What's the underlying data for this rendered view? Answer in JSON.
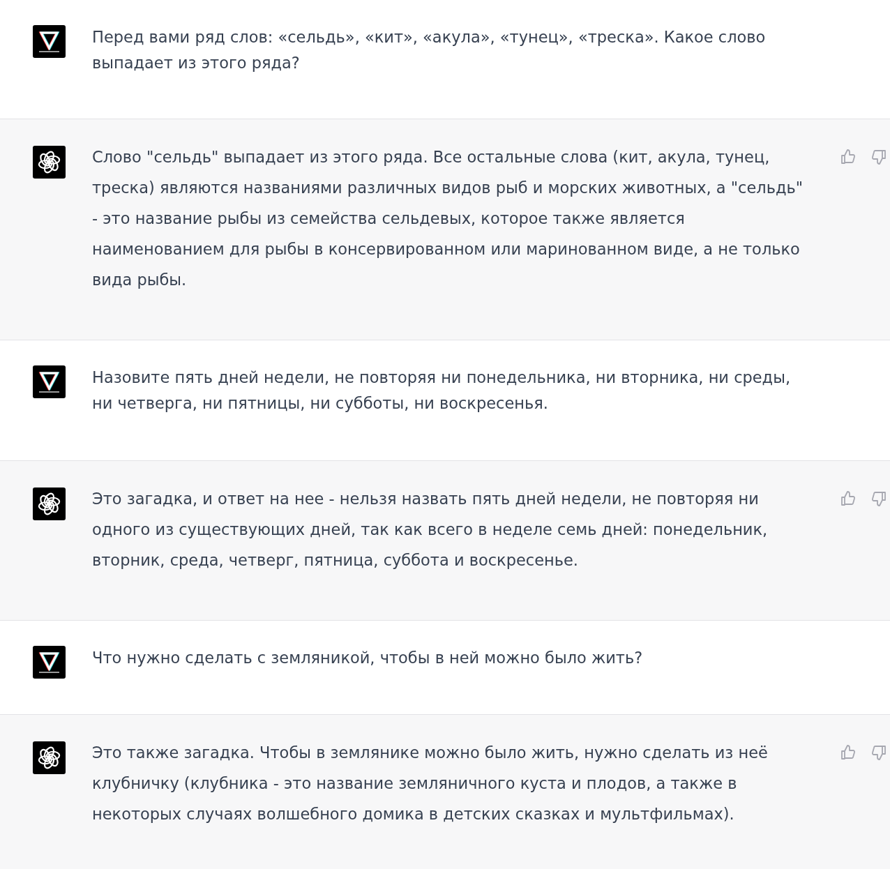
{
  "messages": [
    {
      "kind": "user",
      "text": "Перед вами ряд слов: «сельдь», «кит», «акула», «тунец», «треска». Какое слово выпадает из этого ряда?"
    },
    {
      "kind": "assistant",
      "text": "Слово \"сельдь\" выпадает из этого ряда. Все остальные слова (кит, акула, тунец, треска) являются названиями различных видов рыб и морских животных, а \"сельдь\" - это название рыбы из семейства сельдевых, которое также является наименованием для рыбы в консервированном или маринованном виде, а не только вида рыбы."
    },
    {
      "kind": "user",
      "text": "Назовите пять дней недели, не повторяя ни понедельника, ни вторника, ни среды, ни четверга, ни пятницы, ни субботы, ни воскресенья."
    },
    {
      "kind": "assistant",
      "text": "Это загадка, и ответ на нее - нельзя назвать пять дней недели, не повторяя ни одного из существующих дней, так как всего в неделе семь дней: понедельник, вторник, среда, четверг, пятница, суббота и воскресенье."
    },
    {
      "kind": "user",
      "text": "Что нужно сделать с земляникой, чтобы в ней можно было жить?"
    },
    {
      "kind": "assistant",
      "text": "Это также загадка. Чтобы в землянике можно было жить, нужно сделать из неё клубничку (клубника - это название земляничного куста и плодов, а также в некоторых случаях волшебного домика в детских сказках и мультфильмах)."
    }
  ]
}
